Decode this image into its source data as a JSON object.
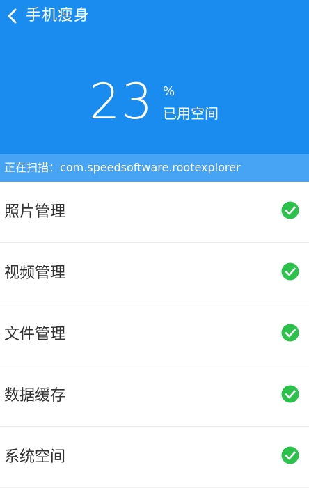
{
  "header": {
    "title": "手机瘦身",
    "usage_percent": "23",
    "usage_unit": "%",
    "usage_label": "已用空间"
  },
  "scan": {
    "prefix": "正在扫描：",
    "target": "com.speedsoftware.rootexplorer"
  },
  "list": {
    "items": [
      {
        "label": "照片管理",
        "status_icon": "check-circle-icon"
      },
      {
        "label": "视频管理",
        "status_icon": "check-circle-icon"
      },
      {
        "label": "文件管理",
        "status_icon": "check-circle-icon"
      },
      {
        "label": "数据缓存",
        "status_icon": "check-circle-icon"
      },
      {
        "label": "系统空间",
        "status_icon": "check-circle-icon"
      }
    ]
  },
  "colors": {
    "header_bg": "#1a8cf0",
    "scan_bar_bg": "#47a3f3",
    "check_green": "#2bc14a"
  }
}
